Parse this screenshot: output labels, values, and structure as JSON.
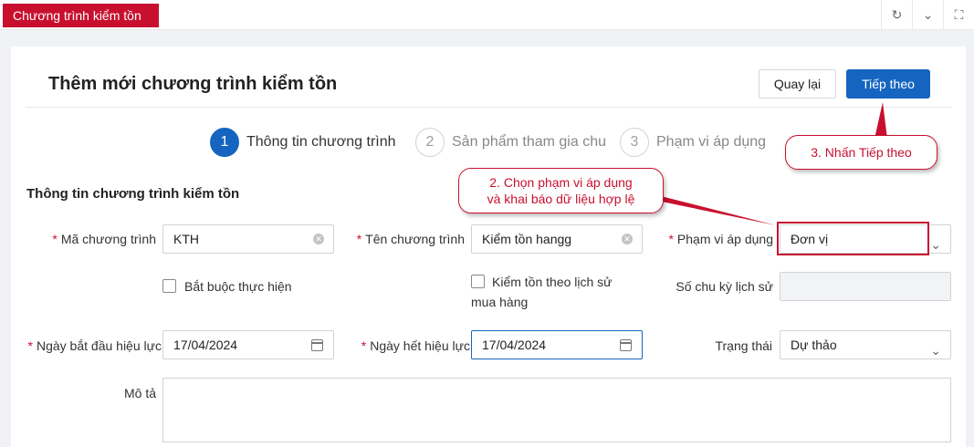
{
  "topbar": {
    "active_tab": "Chương trình kiểm tồn",
    "icons": [
      "refresh-icon",
      "chevron-down-icon",
      "fullscreen-icon"
    ]
  },
  "header": {
    "title": "Thêm mới chương trình kiểm tồn",
    "back_label": "Quay lại",
    "next_label": "Tiếp theo"
  },
  "steps": [
    {
      "num": "1",
      "label": "Thông tin chương trình",
      "active": true
    },
    {
      "num": "2",
      "label": "Sản phẩm tham gia chu",
      "active": false
    },
    {
      "num": "3",
      "label": "Phạm vi áp dụng",
      "active": false
    }
  ],
  "section": {
    "title": "Thông tin chương trình kiểm tồn"
  },
  "form": {
    "ma_chuong_trinh": {
      "label": "Mã chương trình",
      "value": "KTH"
    },
    "ten_chuong_trinh": {
      "label": "Tên chương trình",
      "value": "Kiểm tồn hangg"
    },
    "pham_vi_ap_dung": {
      "label": "Phạm vi áp dụng",
      "value": "Đơn vị"
    },
    "bat_buoc": {
      "label": "Bắt buộc thực hiện"
    },
    "kiem_ton_lich_su": {
      "label_line1": "Kiểm tồn theo lịch sử",
      "label_line2": "mua hàng"
    },
    "so_chu_ky": {
      "label": "Số chu kỳ lịch sử",
      "value": ""
    },
    "ngay_bat_dau": {
      "label": "Ngày bắt đầu hiệu lực",
      "value": "17/04/2024"
    },
    "ngay_het": {
      "label": "Ngày hết hiệu lực",
      "value": "17/04/2024"
    },
    "trang_thai": {
      "label": "Trạng thái",
      "value": "Dự thảo"
    },
    "mo_ta": {
      "label": "Mô tả",
      "value": ""
    }
  },
  "annotations": {
    "callout_2_line1": "2. Chọn phạm vi áp dụng",
    "callout_2_line2": "và khai báo dữ liệu hợp lệ",
    "callout_3": "3. Nhấn Tiếp theo",
    "color": "#c8102e"
  },
  "colors": {
    "brand_red": "#c8102e",
    "primary_blue": "#1565c0"
  }
}
